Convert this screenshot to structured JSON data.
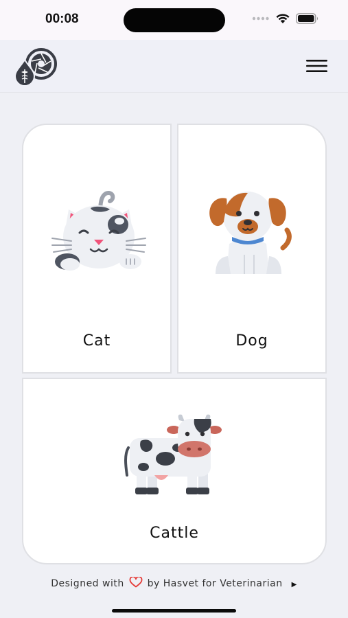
{
  "status_bar": {
    "time": "00:08",
    "icons": [
      "cellular-dots-icon",
      "wifi-icon",
      "battery-icon"
    ]
  },
  "header": {
    "logo": "hasvet-logo",
    "menu_icon": "hamburger-menu-icon"
  },
  "categories": [
    {
      "label": "Cat",
      "icon": "cat-icon"
    },
    {
      "label": "Dog",
      "icon": "dog-icon"
    },
    {
      "label": "Cattle",
      "icon": "cow-icon"
    }
  ],
  "footer": {
    "prefix": "Designed with",
    "suffix": "by Hasvet for Veterinarian",
    "heart_icon": "heart-icon",
    "heart_color": "#e53935",
    "arrow_icon": "caret-right-icon"
  },
  "colors": {
    "background": "#eff0f5",
    "card": "#ffffff",
    "card_border": "#dfe0e4",
    "logo": "#3a3d46"
  }
}
